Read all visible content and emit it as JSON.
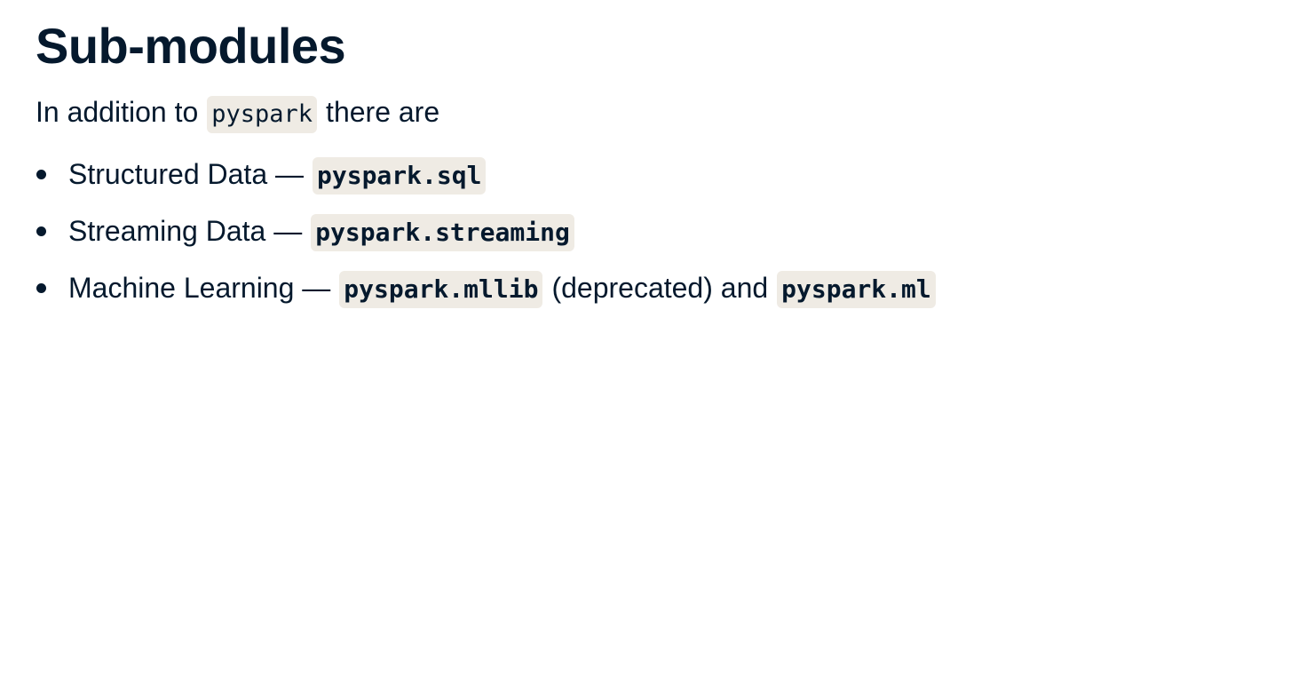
{
  "slide": {
    "title": "Sub-modules",
    "intro": {
      "before": "In addition to",
      "code": "pyspark",
      "after": "there are"
    },
    "items": [
      {
        "label": "Structured Data —",
        "code": "pyspark.sql"
      },
      {
        "label": "Streaming Data —",
        "code": "pyspark.streaming"
      },
      {
        "label": "Machine Learning —",
        "code": "pyspark.mllib",
        "middle": "(deprecated) and",
        "code2": "pyspark.ml"
      }
    ]
  },
  "colors": {
    "text": "#05192d",
    "code_background": "#efebe4",
    "background": "#ffffff"
  }
}
